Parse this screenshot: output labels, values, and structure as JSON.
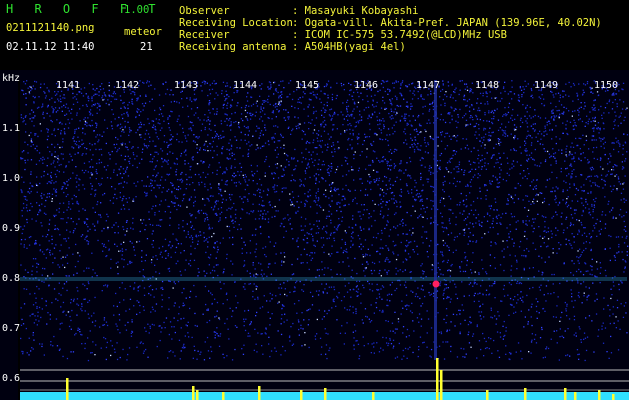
{
  "header": {
    "app_name": "H R O F F T",
    "version": "1.00",
    "filename": "0211121140.png",
    "datetime": "02.11.12 11:40",
    "meteor_label": "meteor",
    "meteor_count": "21",
    "fields": [
      {
        "label": "Observer",
        "value": ": Masayuki Kobayashi"
      },
      {
        "label": "Receiving Location",
        "value": ": Ogata-vill. Akita-Pref. JAPAN (139.96E, 40.02N)"
      },
      {
        "label": "Receiver",
        "value": ": ICOM IC-575 53.7492(@LCD)MHz USB"
      },
      {
        "label": "Receiving antenna",
        "value": ": A504HB(yagi 4el)"
      }
    ]
  },
  "spectrogram": {
    "unit_label": "kHz",
    "y_ticks": [
      "1.1",
      "1.0",
      "0.9",
      "0.8",
      "0.7",
      "0.6"
    ],
    "x_ticks": [
      "1141",
      "1142",
      "1143",
      "1144",
      "1145",
      "1146",
      "1147",
      "1148",
      "1149",
      "1150"
    ],
    "colors": {
      "background": "#000010",
      "noise": "#1a2ac8",
      "signal": "#3fd0ff",
      "histogram": "#ffff30",
      "baseline": "#30e0ff",
      "peak": "#ff2060"
    }
  }
}
